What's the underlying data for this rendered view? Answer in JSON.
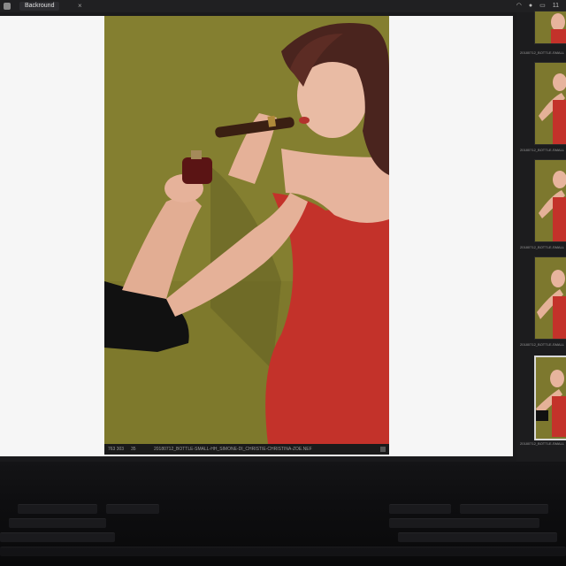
{
  "window": {
    "tab_title": "Backround",
    "close_glyph": "×",
    "status_icons": [
      "wifi-icon",
      "user-icon",
      "battery-icon"
    ],
    "status_text": "11"
  },
  "viewer": {
    "photo_caption": {
      "dims": "763 303",
      "number": "35",
      "filename": "20180712_BOTTLE-SMALL-HH_SIMONE-DI_CHRISTIE-CHRISTINA-ZOE.NEF"
    }
  },
  "filmstrip": {
    "items": [
      {
        "label": "20180712_BOTTLE-SMALL",
        "selected": false
      },
      {
        "label": "20180712_BOTTLE-SMALL",
        "selected": false
      },
      {
        "label": "20180712_BOTTLE-SMALL",
        "selected": false
      },
      {
        "label": "20180712_BOTTLE-SMALL",
        "selected": false
      },
      {
        "label": "20180712_BOTTLE-SMALL",
        "selected": true
      }
    ]
  },
  "colors": {
    "backdrop": "#8a8533",
    "dress": "#c3322a",
    "skin": "#e7b49d",
    "hair": "#4a241e",
    "sleeve": "#111111",
    "viewer_bg": "#f6f6f6"
  }
}
